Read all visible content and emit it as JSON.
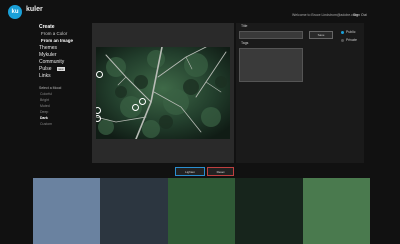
{
  "header": {
    "logo_mark": "ku",
    "brand": "kuler",
    "welcome": "Welcome to Bruce Lindstrom@adobe.com",
    "signout": "Sign Out"
  },
  "nav": {
    "create": "Create",
    "from_color": "From a Color",
    "from_image": "From an Image",
    "themes": "Themes",
    "mykuler": "Mykuler",
    "community": "Community",
    "pulse": "Pulse",
    "pulse_badge": "new",
    "links": "Links"
  },
  "mood": {
    "header": "Select a Mood",
    "items": [
      "Colorful",
      "Bright",
      "Muted",
      "Deep",
      "Dark",
      "Custom"
    ],
    "selected": "Dark"
  },
  "editor": {
    "lighten_label": "Lighten",
    "reset_label": "Reset"
  },
  "save_panel": {
    "title_label": "Title",
    "title_value": "",
    "save_label": "Save",
    "tags_label": "Tags",
    "tags_value": "",
    "public_label": "Public",
    "private_label": "Private"
  },
  "swatch_colors": [
    "#6a82a0",
    "#2c3640",
    "#2f5a36",
    "#17251c",
    "#4a7a4e"
  ]
}
